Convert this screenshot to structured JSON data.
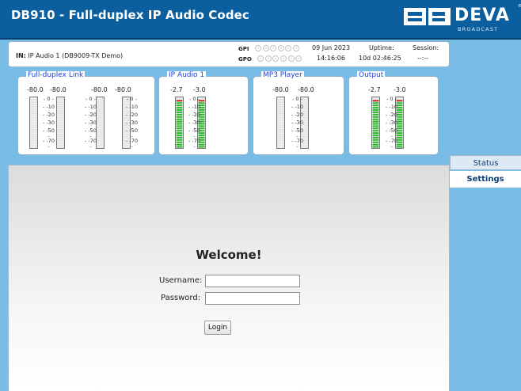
{
  "header": {
    "title": "DB910 - Full-duplex IP Audio Codec",
    "brand": "DEVA",
    "brand_sub": "BROADCAST",
    "reg": "®"
  },
  "infobar": {
    "in_label": "IN:",
    "in_value": "IP Audio 1 (DB9009-TX Demo)",
    "gpi_label": "GPI",
    "gpo_label": "GPO",
    "gpi_dots": [
      "1",
      "2",
      "3",
      "4",
      "5",
      "6"
    ],
    "gpo_dots": [
      "1",
      "2",
      "3",
      "4",
      "5",
      "6"
    ],
    "date": "09 Jun 2023",
    "time": "14:16:06",
    "uptime_label": "Uptime:",
    "uptime_value": "10d 02:46:25",
    "session_label": "Session:",
    "session_value": "--:--"
  },
  "meters": [
    {
      "name": "Full-duplex Link",
      "readings": [
        "-80.0",
        "-80.0",
        "-80.0",
        "-80.0"
      ],
      "levels": [
        0.03,
        0.03,
        0.03,
        0.03
      ]
    },
    {
      "name": "IP Audio 1",
      "readings": [
        "-2.7",
        "-3.0"
      ],
      "levels": [
        0.98,
        0.98
      ]
    },
    {
      "name": "MP3 Player",
      "readings": [
        "-80.0",
        "-80.0"
      ],
      "levels": [
        0.03,
        0.03
      ]
    },
    {
      "name": "Output",
      "readings": [
        "-2.7",
        "-3.0"
      ],
      "levels": [
        0.98,
        0.98
      ]
    }
  ],
  "scale": [
    "0",
    "-10",
    "-20",
    "-30",
    "-50",
    "-70"
  ],
  "tabs": {
    "status": "Status",
    "settings": "Settings"
  },
  "login": {
    "welcome": "Welcome!",
    "username_label": "Username:",
    "password_label": "Password:",
    "username_value": "",
    "password_value": "",
    "login_label": "Login"
  },
  "colors": {
    "header": "#0b5f9e",
    "background": "#79bde6",
    "meter_green": "#1fbf1f",
    "meter_red": "#d01818",
    "legend": "#1e3fd6"
  }
}
